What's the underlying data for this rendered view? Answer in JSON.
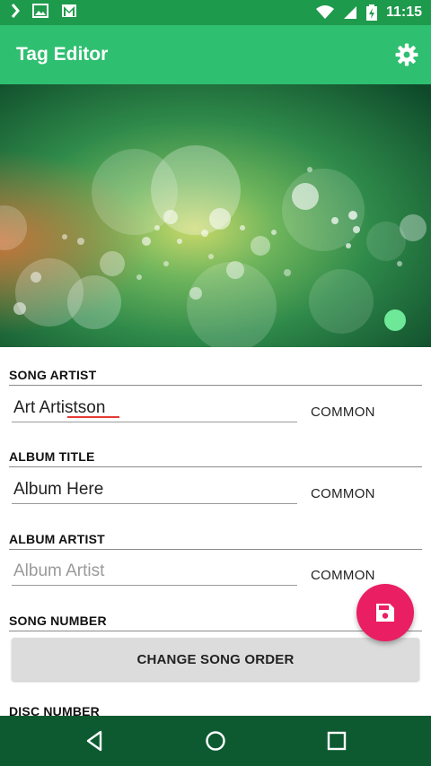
{
  "status_bar": {
    "time": "11:15",
    "icons": [
      "chevron-right-icon",
      "image-icon",
      "gmail-icon",
      "wifi-icon",
      "signal-icon",
      "battery-charging-icon"
    ]
  },
  "app_bar": {
    "title": "Tag Editor",
    "settings_icon": "gear-icon"
  },
  "fields": [
    {
      "label": "SONG ARTIST",
      "value": "Art Artistson",
      "placeholder": "Song Artist",
      "action": "COMMON"
    },
    {
      "label": "ALBUM TITLE",
      "value": "Album Here",
      "placeholder": "Album Title",
      "action": "COMMON"
    },
    {
      "label": "ALBUM ARTIST",
      "value": "",
      "placeholder": "Album Artist",
      "action": "COMMON"
    }
  ],
  "song_number": {
    "label": "SONG NUMBER",
    "button_label": "CHANGE SONG ORDER"
  },
  "disc_number": {
    "label": "DISC NUMBER"
  },
  "fab": {
    "icon": "save-icon",
    "color": "#e91e63"
  },
  "colors": {
    "status_bar": "#1e9a4c",
    "app_bar": "#2fbf71",
    "nav_bar": "#0d5a31"
  },
  "nav": [
    "back-icon",
    "home-icon",
    "recents-icon"
  ]
}
